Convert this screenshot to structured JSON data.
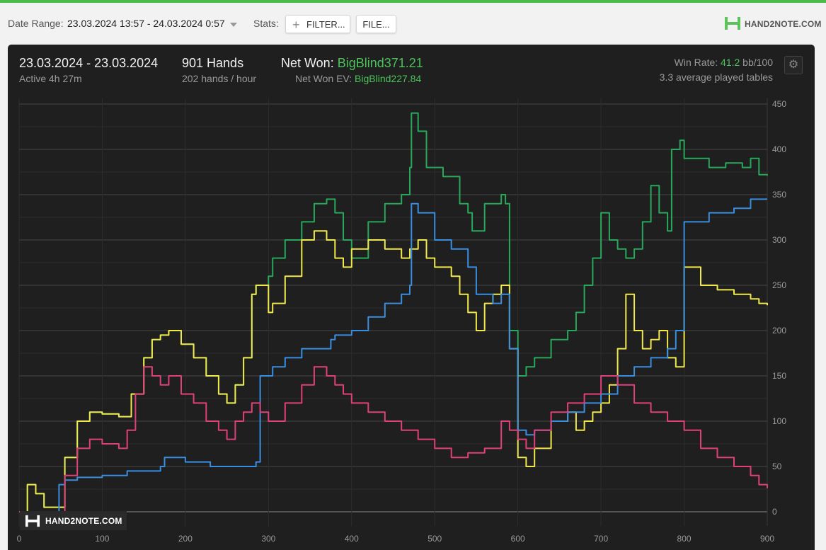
{
  "toolbar": {
    "date_range_label": "Date Range:",
    "date_range_value": "23.03.2024 13:57 - 24.03.2024 0:57",
    "stats_label": "Stats:",
    "filter_label": "FILTER...",
    "file_label": "FILE...",
    "logo_text": "HAND2NOTE.COM"
  },
  "summary": {
    "date_span": "23.03.2024 - 23.03.2024",
    "active_time": "Active 4h 27m",
    "hands": "901 Hands",
    "hands_per_hour": "202 hands / hour",
    "net_won_label": "Net Won:",
    "net_won_value": "BigBlind371.21",
    "net_won_ev_label": "Net Won  EV:",
    "net_won_ev_value": "BigBlind227.84",
    "win_rate_label": "Win Rate:",
    "win_rate_value": "41.2",
    "win_rate_unit": "bb/100",
    "tables": "3.3 average played tables"
  },
  "watermark": "HAND2NOTE.COM",
  "colors": {
    "accent": "#4cbd4c",
    "net_won": "#28a85a",
    "ev": "#f1e84b",
    "showdown": "#3a8ee0",
    "non_showdown": "#e0407a",
    "panel": "#1f1f1f",
    "grid": "#444444"
  },
  "chart_data": {
    "type": "line",
    "xlim": [
      0,
      900
    ],
    "ylim": [
      0,
      450
    ],
    "x_ticks": [
      "0",
      "100",
      "200",
      "300",
      "400",
      "500",
      "600",
      "700",
      "800",
      "900"
    ],
    "y_ticks": [
      "0",
      "50",
      "100",
      "150",
      "200",
      "250",
      "300",
      "350",
      "400",
      "450"
    ],
    "grid": true,
    "series": [
      {
        "color": "green",
        "x": [
          0,
          10,
          20,
          30,
          45,
          55,
          70,
          85,
          100,
          120,
          135,
          150,
          160,
          170,
          180,
          195,
          210,
          225,
          240,
          250,
          260,
          270,
          280,
          285,
          300,
          305,
          320,
          340,
          355,
          370,
          380,
          390,
          400,
          420,
          440,
          460,
          470,
          472,
          480,
          490,
          510,
          530,
          540,
          545,
          560,
          580,
          585,
          590,
          600,
          610,
          620,
          640,
          660,
          670,
          680,
          690,
          700,
          710,
          720,
          730,
          740,
          750,
          760,
          770,
          780,
          785,
          795,
          800,
          830,
          850,
          870,
          880,
          890,
          900
        ],
        "y": [
          0,
          30,
          20,
          5,
          5,
          60,
          100,
          110,
          108,
          105,
          130,
          170,
          190,
          195,
          200,
          185,
          170,
          150,
          130,
          120,
          140,
          170,
          240,
          250,
          260,
          280,
          300,
          320,
          340,
          345,
          330,
          300,
          280,
          320,
          340,
          350,
          380,
          440,
          420,
          380,
          370,
          340,
          330,
          310,
          340,
          350,
          340,
          200,
          150,
          160,
          170,
          190,
          200,
          220,
          250,
          280,
          330,
          300,
          290,
          280,
          290,
          320,
          360,
          330,
          310,
          400,
          410,
          390,
          380,
          385,
          380,
          390,
          372,
          371
        ],
        "name": ""
      },
      {
        "color": "yellow",
        "x": [
          0,
          10,
          20,
          30,
          45,
          55,
          70,
          85,
          100,
          120,
          135,
          150,
          160,
          170,
          180,
          195,
          210,
          225,
          240,
          250,
          260,
          270,
          280,
          285,
          300,
          305,
          320,
          340,
          355,
          370,
          380,
          390,
          400,
          420,
          440,
          460,
          470,
          480,
          490,
          500,
          520,
          530,
          540,
          550,
          560,
          570,
          580,
          590,
          600,
          610,
          620,
          640,
          660,
          670,
          680,
          690,
          700,
          710,
          720,
          730,
          740,
          750,
          760,
          770,
          780,
          790,
          800,
          820,
          840,
          860,
          880,
          890,
          900
        ],
        "y": [
          0,
          30,
          20,
          5,
          5,
          60,
          100,
          110,
          108,
          105,
          130,
          170,
          190,
          195,
          200,
          185,
          170,
          150,
          130,
          120,
          140,
          170,
          240,
          250,
          220,
          230,
          260,
          300,
          310,
          300,
          280,
          270,
          290,
          300,
          290,
          280,
          290,
          300,
          280,
          270,
          260,
          240,
          220,
          200,
          230,
          240,
          250,
          180,
          60,
          50,
          70,
          100,
          110,
          90,
          100,
          110,
          120,
          140,
          180,
          240,
          200,
          180,
          190,
          200,
          170,
          160,
          270,
          250,
          245,
          240,
          235,
          230,
          228
        ],
        "name": ""
      },
      {
        "color": "blue",
        "x": [
          0,
          45,
          48,
          55,
          70,
          100,
          130,
          170,
          175,
          200,
          230,
          260,
          285,
          290,
          305,
          320,
          340,
          355,
          375,
          380,
          400,
          420,
          440,
          460,
          470,
          472,
          480,
          500,
          520,
          540,
          550,
          570,
          580,
          590,
          600,
          610,
          620,
          640,
          660,
          680,
          700,
          720,
          740,
          760,
          780,
          790,
          800,
          830,
          860,
          880,
          900
        ],
        "y": [
          0,
          0,
          30,
          35,
          38,
          40,
          45,
          50,
          60,
          55,
          50,
          50,
          55,
          150,
          160,
          170,
          180,
          180,
          190,
          195,
          200,
          215,
          230,
          240,
          250,
          340,
          330,
          300,
          290,
          270,
          240,
          230,
          240,
          180,
          90,
          85,
          90,
          100,
          110,
          120,
          130,
          150,
          160,
          170,
          180,
          200,
          320,
          330,
          335,
          345,
          345
        ],
        "name": ""
      },
      {
        "color": "pink",
        "x": [
          0,
          45,
          55,
          70,
          85,
          100,
          120,
          130,
          140,
          150,
          160,
          170,
          180,
          195,
          210,
          225,
          240,
          250,
          260,
          270,
          280,
          290,
          300,
          320,
          340,
          355,
          370,
          380,
          390,
          400,
          420,
          440,
          460,
          480,
          500,
          520,
          540,
          560,
          580,
          590,
          600,
          610,
          620,
          640,
          660,
          680,
          700,
          720,
          740,
          760,
          780,
          800,
          820,
          840,
          860,
          880,
          890,
          900
        ],
        "y": [
          0,
          0,
          40,
          70,
          80,
          75,
          70,
          90,
          130,
          160,
          150,
          140,
          150,
          130,
          120,
          100,
          90,
          80,
          100,
          110,
          120,
          110,
          100,
          120,
          140,
          160,
          150,
          140,
          130,
          120,
          110,
          100,
          90,
          80,
          70,
          60,
          65,
          70,
          100,
          90,
          80,
          70,
          90,
          110,
          120,
          130,
          150,
          140,
          120,
          110,
          100,
          90,
          70,
          60,
          50,
          40,
          30,
          26
        ],
        "name": ""
      }
    ]
  }
}
